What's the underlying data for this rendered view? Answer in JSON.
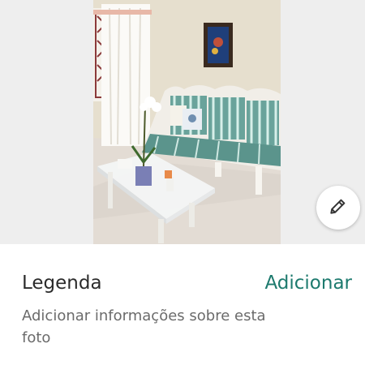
{
  "photo": {
    "icon": "photo-living-room"
  },
  "edit_button": {
    "icon": "pencil-icon"
  },
  "caption": {
    "label": "Legenda",
    "action": "Adicionar",
    "description": "Adicionar informações sobre esta foto"
  },
  "colors": {
    "accent": "#1d7a6e",
    "text_primary": "#2b2b2b",
    "text_secondary": "#6b6b6b",
    "photo_backdrop": "#eeeeee"
  }
}
